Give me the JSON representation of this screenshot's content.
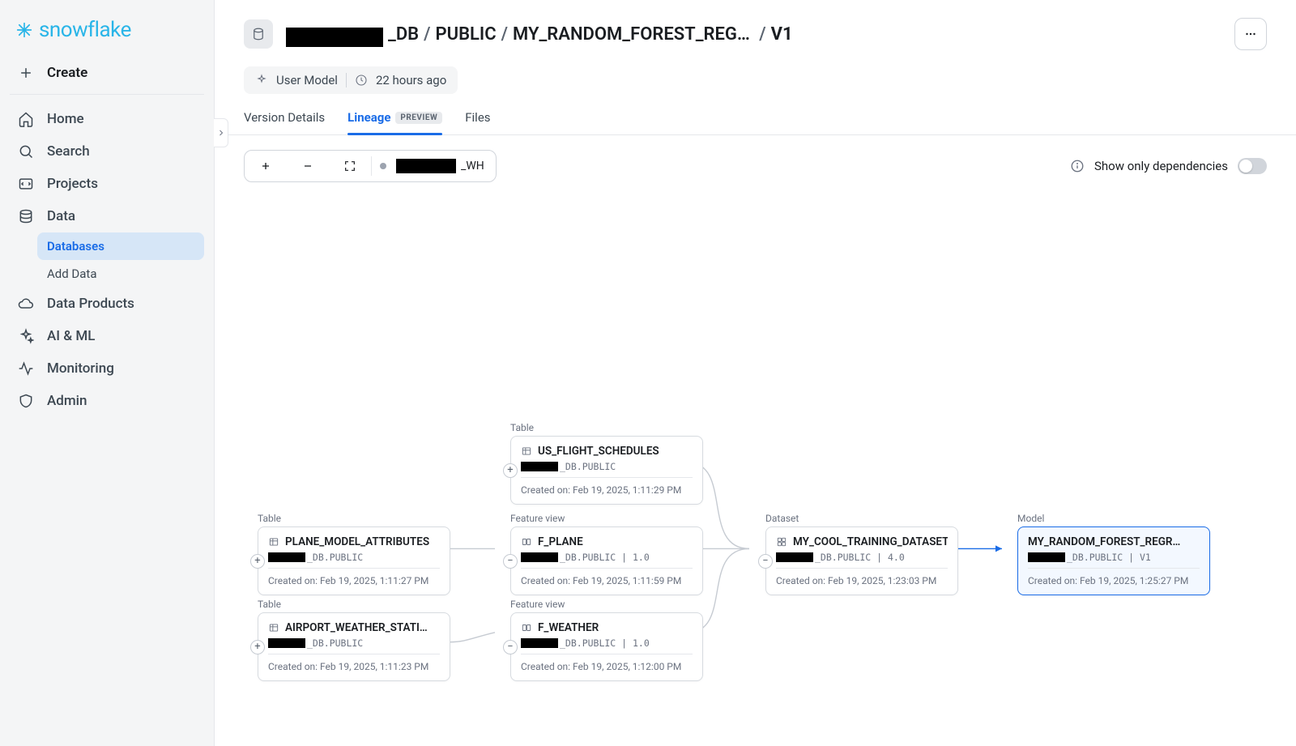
{
  "brand": "snowflake",
  "sidebar": {
    "create": "Create",
    "items": [
      {
        "label": "Home"
      },
      {
        "label": "Search"
      },
      {
        "label": "Projects"
      },
      {
        "label": "Data"
      },
      {
        "label": "Data Products"
      },
      {
        "label": "AI & ML"
      },
      {
        "label": "Monitoring"
      },
      {
        "label": "Admin"
      }
    ],
    "data_sub": [
      {
        "label": "Databases",
        "active": true
      },
      {
        "label": "Add Data",
        "active": false
      }
    ]
  },
  "breadcrumb": {
    "seg1_suffix": "_DB",
    "seg2": "PUBLIC",
    "seg3": "MY_RANDOM_FOREST_REG…",
    "seg4": "V1"
  },
  "meta": {
    "type": "User Model",
    "age": "22 hours ago"
  },
  "tabs": {
    "version_details": "Version Details",
    "lineage": "Lineage",
    "preview_badge": "PREVIEW",
    "files": "Files"
  },
  "toolbar": {
    "wh_suffix": "_WH",
    "deps_label": "Show only dependencies"
  },
  "nodes": {
    "table_label": "Table",
    "feature_view_label": "Feature view",
    "dataset_label": "Dataset",
    "model_label": "Model",
    "created_prefix": "Created on: ",
    "us_flight": {
      "title": "US_FLIGHT_SCHEDULES",
      "path_suffix": "_DB.PUBLIC",
      "created": "Feb 19, 2025, 1:11:29 PM"
    },
    "plane_model": {
      "title": "PLANE_MODEL_ATTRIBUTES",
      "path_suffix": "_DB.PUBLIC",
      "created": "Feb 19, 2025, 1:11:27 PM"
    },
    "airport_weather": {
      "title": "AIRPORT_WEATHER_STATI…",
      "path_suffix": "_DB.PUBLIC",
      "created": "Feb 19, 2025, 1:11:23 PM"
    },
    "f_plane": {
      "title": "F_PLANE",
      "path_suffix": "_DB.PUBLIC | 1.0",
      "created": "Feb 19, 2025, 1:11:59 PM"
    },
    "f_weather": {
      "title": "F_WEATHER",
      "path_suffix": "_DB.PUBLIC | 1.0",
      "created": "Feb 19, 2025, 1:12:00 PM"
    },
    "dataset": {
      "title": "MY_COOL_TRAINING_DATASET",
      "path_suffix": "_DB.PUBLIC | 4.0",
      "created": "Feb 19, 2025, 1:23:03 PM"
    },
    "model": {
      "title": "MY_RANDOM_FOREST_REGR…",
      "path_suffix": "_DB.PUBLIC | V1",
      "created": "Feb 19, 2025, 1:25:27 PM"
    }
  }
}
